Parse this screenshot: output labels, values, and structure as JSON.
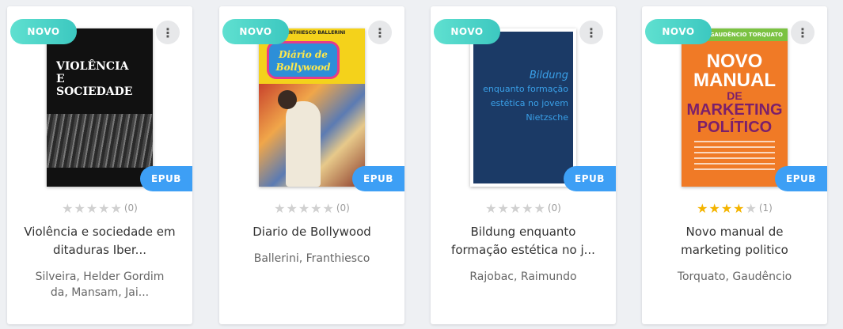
{
  "books": [
    {
      "badge_new": "NOVO",
      "menu_icon": "⋮",
      "format": "EPUB",
      "rating": 0,
      "rating_count": "(0)",
      "title_line1": "Violência e sociedade em",
      "title_line2": "ditaduras Iber...",
      "author_line1": "Silveira, Helder Gordim",
      "author_line2": "da, Mansam, Jai...",
      "cover": {
        "title": "VIOLÊNCIA\nE\nSOCIEDADE"
      }
    },
    {
      "badge_new": "NOVO",
      "menu_icon": "⋮",
      "format": "EPUB",
      "rating": 0,
      "rating_count": "(0)",
      "title_line1": "Diario de Bollywood",
      "author_line1": "Ballerini, Franthiesco",
      "cover": {
        "author": "FRANTHIESCO BALLERINI",
        "title": "Diário de Bollywood"
      }
    },
    {
      "badge_new": "NOVO",
      "menu_icon": "⋮",
      "format": "EPUB",
      "rating": 0,
      "rating_count": "(0)",
      "title_line1": "Bildung enquanto",
      "title_line2": "formação estética no j...",
      "author_line1": "Rajobac, Raimundo",
      "cover": {
        "line1": "Bildung",
        "line2": "enquanto formação",
        "line3": "estética no jovem",
        "line4": "Nietzsche"
      }
    },
    {
      "badge_new": "NOVO",
      "menu_icon": "⋮",
      "format": "EPUB",
      "rating": 4,
      "rating_count": "(1)",
      "title_line1": "Novo manual de",
      "title_line2": "marketing politico",
      "author_line1": "Torquato, Gaudêncio",
      "cover": {
        "author": "GAUDÊNCIO TORQUATO",
        "line1": "NOVO",
        "line2": "MANUAL",
        "line3": "DE",
        "line4": "MARKETING",
        "line5": "POLÍTICO"
      }
    }
  ],
  "colors": {
    "novo_badge": "#3cc8c0",
    "epub_badge": "#3d9ff5",
    "star_on": "#f4b400",
    "star_off": "#d0d0d0"
  }
}
